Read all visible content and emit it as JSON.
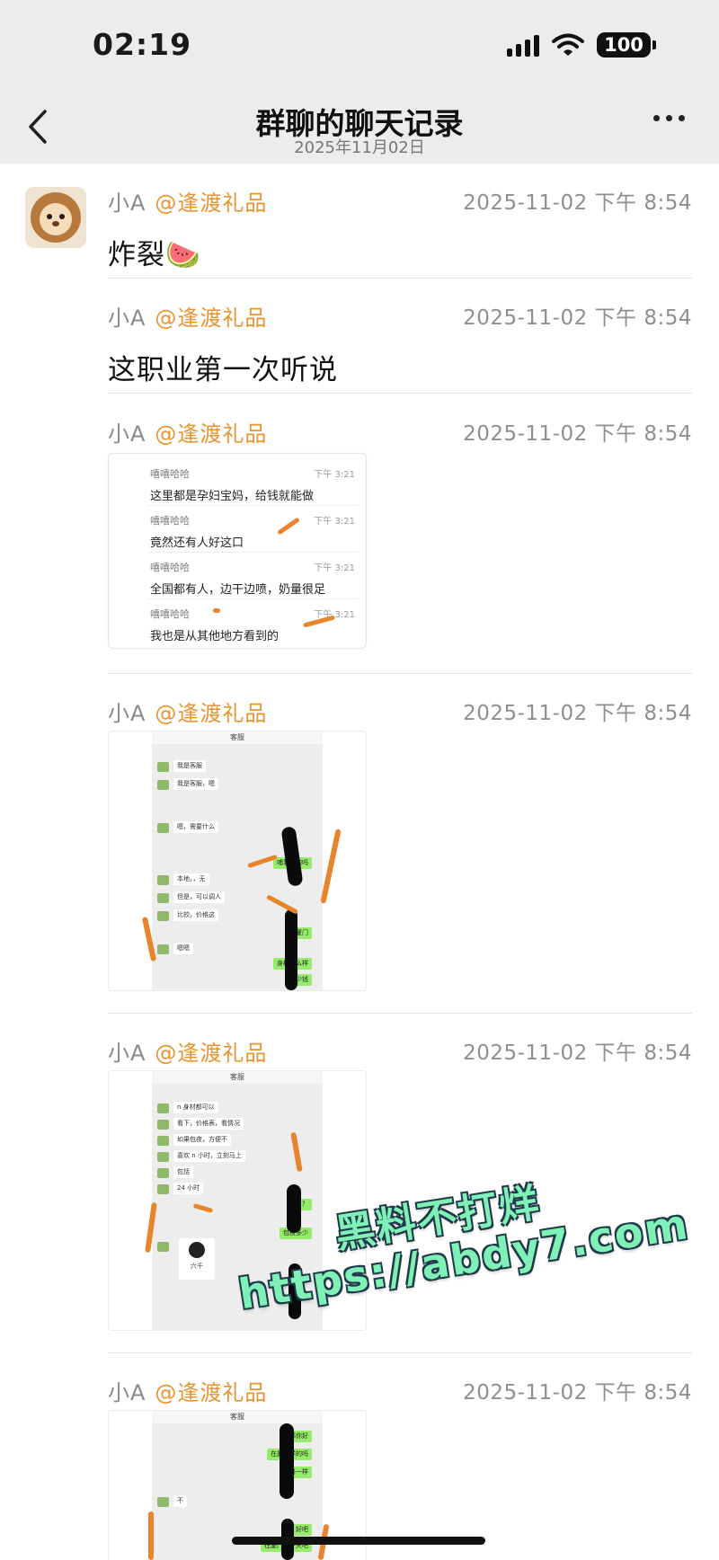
{
  "status_bar": {
    "time": "02:19",
    "battery": "100"
  },
  "nav": {
    "title": "群聊的聊天记录",
    "subtitle": "2025年11月02日"
  },
  "messages": [
    {
      "sender": "小A",
      "mention": "@逢渡礼品",
      "timestamp": "2025-11-02 下午 8:54",
      "text": "炸裂🍉"
    },
    {
      "sender": "小A",
      "mention": "@逢渡礼品",
      "timestamp": "2025-11-02 下午 8:54",
      "text": "这职业第一次听说"
    },
    {
      "sender": "小A",
      "mention": "@逢渡礼品",
      "timestamp": "2025-11-02 下午 8:54"
    },
    {
      "sender": "小A",
      "mention": "@逢渡礼品",
      "timestamp": "2025-11-02 下午 8:54"
    },
    {
      "sender": "小A",
      "mention": "@逢渡礼品",
      "timestamp": "2025-11-02 下午 8:54"
    },
    {
      "sender": "小A",
      "mention": "@逢渡礼品",
      "timestamp": "2025-11-02 下午 8:54"
    }
  ],
  "quoted_record": {
    "items": [
      {
        "name": "嘻嘻哈哈",
        "time": "下午 3:21",
        "text": "这里都是孕妇宝妈，给钱就能做"
      },
      {
        "name": "嘻嘻哈哈",
        "time": "下午 3:21",
        "text": "竟然还有人好这口"
      },
      {
        "name": "嘻嘻哈哈",
        "time": "下午 3:21",
        "text": "全国都有人，边干边喷，奶量很足"
      },
      {
        "name": "嘻嘻哈哈",
        "time": "下午 3:21",
        "text": "我也是从其他地方看到的"
      }
    ]
  },
  "screenshots": [
    {
      "title": "客服",
      "bubbles": [
        {
          "side": "l",
          "text": "我是客服"
        },
        {
          "side": "l",
          "text": "我是客服，嗯"
        },
        {
          "side": "l",
          "text": "嗯，需要什么"
        },
        {
          "side": "r",
          "text": "哺乳期的吗"
        },
        {
          "side": "l",
          "text": "本地，，无"
        },
        {
          "side": "l",
          "text": "但是，可以调人"
        },
        {
          "side": "l",
          "text": "比较，价格这"
        },
        {
          "side": "r",
          "text": "厦门"
        },
        {
          "side": "l",
          "text": "嗯嗯"
        },
        {
          "side": "r",
          "text": "身材怎么样"
        },
        {
          "side": "r",
          "text": "多少钱"
        }
      ]
    },
    {
      "title": "客服",
      "bubbles": [
        {
          "side": "l",
          "text": "n 身材都可以"
        },
        {
          "side": "l",
          "text": "看下，价格表，看情况"
        },
        {
          "side": "l",
          "text": "如果包夜，方便不"
        },
        {
          "side": "l",
          "text": "喜欢 n 小时，立刻马上"
        },
        {
          "side": "l",
          "text": "包括"
        },
        {
          "side": "l",
          "text": "24 小时"
        },
        {
          "side": "r",
          "text": "？？"
        },
        {
          "side": "r",
          "text": "包夜多少"
        }
      ],
      "sticker_caption": "六千"
    },
    {
      "title": "客服",
      "bubbles": [
        {
          "side": "r",
          "text": "那你好"
        },
        {
          "side": "r",
          "text": "在厦一样的吗"
        },
        {
          "side": "r",
          "text": "价格一样"
        },
        {
          "side": "l",
          "text": "不"
        },
        {
          "side": "r",
          "text": "好吧"
        },
        {
          "side": "r",
          "text": "在厦门的一天吧"
        }
      ]
    }
  ],
  "watermark": {
    "line1": "黑料不打烊",
    "line2": "https://abdy7.com"
  },
  "colors": {
    "mention": "#e8952f",
    "header_bg": "#ececec",
    "watermark": "#7ff1b6",
    "wechat_green": "#95ec69"
  }
}
